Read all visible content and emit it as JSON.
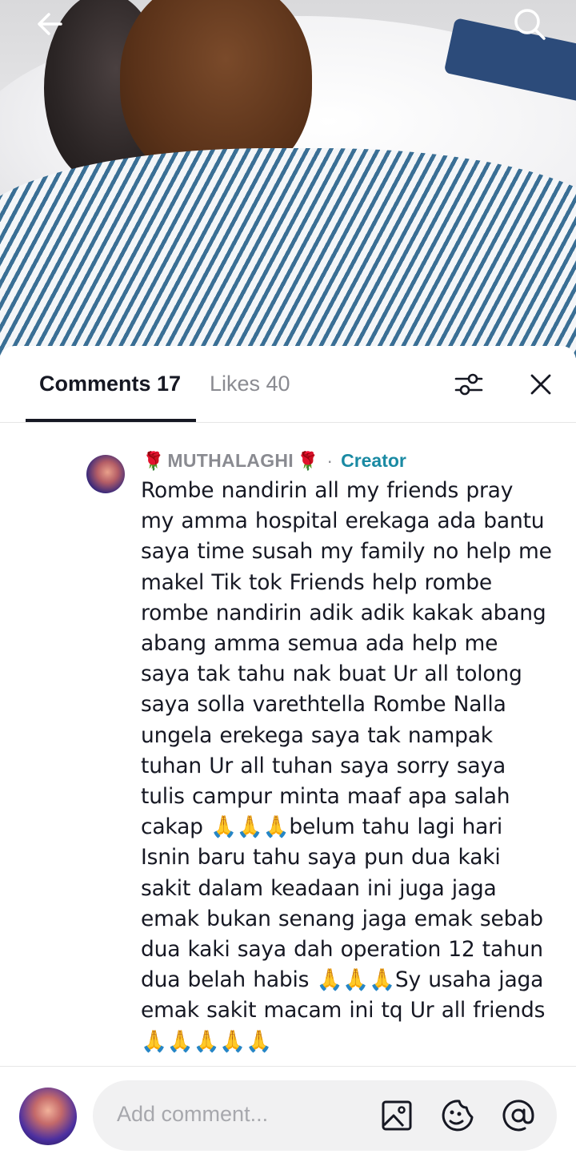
{
  "video": {
    "icons": {
      "back": "arrow-left-icon",
      "search": "search-icon"
    }
  },
  "tabs": {
    "comments_label": "Comments 17",
    "likes_label": "Likes 40",
    "icons": {
      "filter": "sliders-icon",
      "close": "close-icon"
    }
  },
  "comment": {
    "rose": "🌹",
    "username": "MUTHALAGHI",
    "separator": "·",
    "creator_badge": "Creator",
    "text": "Rombe nandirin all my friends pray my amma hospital erekaga ada bantu saya time susah my family no help me makel Tik tok Friends help rombe rombe nandirin adik adik kakak abang abang amma semua ada help me saya tak tahu nak buat Ur all tolong saya solla varethtella Rombe Nalla ungela erekega saya tak nampak tuhan Ur all tuhan saya sorry saya tulis campur minta maaf apa salah cakap 🙏🙏🙏belum tahu lagi hari Isnin baru tahu saya pun dua kaki sakit dalam keadaan ini juga jaga emak bukan senang jaga emak sebab dua kaki saya dah operation 12 tahun dua belah habis 🙏🙏🙏Sy usaha jaga emak sakit macam ini tq Ur all friends 🙏🙏🙏🙏🙏"
  },
  "composer": {
    "placeholder": "Add comment...",
    "icons": {
      "image": "image-icon",
      "emoji": "emoji-icon",
      "mention": "at-mention-icon"
    }
  },
  "colors": {
    "creator": "#1a8aa3",
    "text": "#161823",
    "muted": "#8a8b91"
  }
}
